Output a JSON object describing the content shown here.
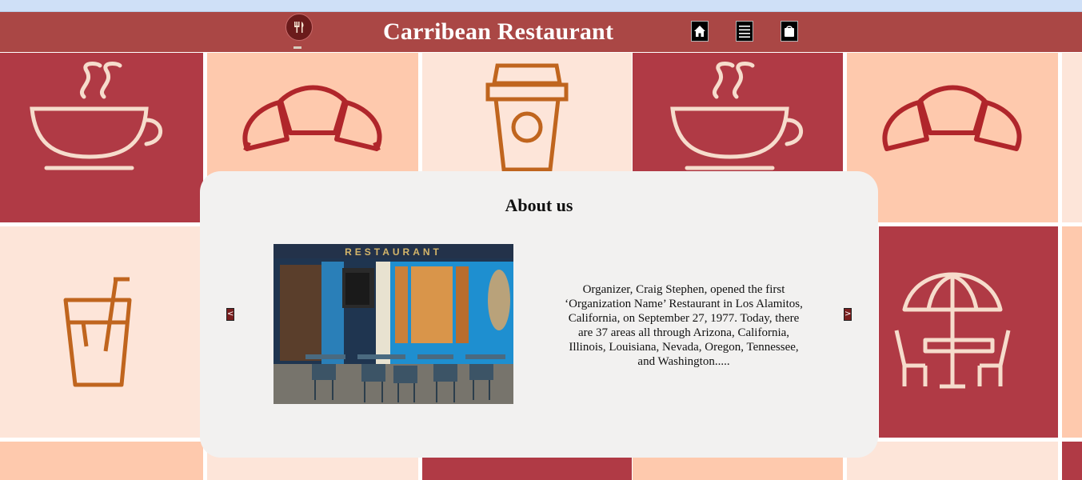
{
  "header": {
    "title": "Carribean Restaurant",
    "logo_icon": "fork-knife-icon",
    "nav": [
      {
        "icon": "home-icon"
      },
      {
        "icon": "menu-lines-icon"
      },
      {
        "icon": "bag-icon"
      }
    ],
    "bg_color": "#aa4745"
  },
  "background_tiles": [
    {
      "icon": "coffee-cup-icon",
      "color": "#b03a45"
    },
    {
      "icon": "croissant-icon",
      "color": "#fec9ad"
    },
    {
      "icon": "takeaway-cup-icon",
      "color": "#fde5d9"
    },
    {
      "icon": "coffee-cup-icon",
      "color": "#b03a45"
    },
    {
      "icon": "croissant-icon",
      "color": "#fec9ad"
    },
    {
      "icon": "iced-drink-icon",
      "color": "#fde5d9"
    },
    {
      "icon": "patio-table-umbrella-icon",
      "color": "#b03a45"
    }
  ],
  "about": {
    "title": "About us",
    "prev_label": "<",
    "next_label": ">",
    "image_sign_text": "RESTAURANT",
    "text": "Organizer, Craig Stephen, opened the first ‘Organization Name’ Restaurant in Los Alamitos, California, on September 27, 1977. Today, there are 37 areas all through Arizona, California, Illinois, Louisiana, Nevada, Oregon, Tennessee, and Washington....."
  }
}
